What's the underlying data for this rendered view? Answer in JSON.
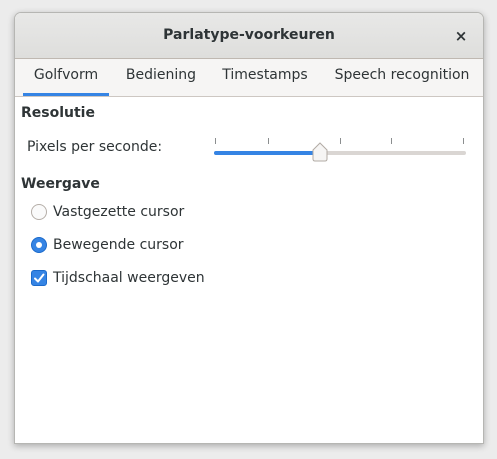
{
  "window": {
    "title": "Parlatype-voorkeuren",
    "close_glyph": "×"
  },
  "tabs": [
    {
      "label": "Golfvorm",
      "active": true
    },
    {
      "label": "Bediening",
      "active": false
    },
    {
      "label": "Timestamps",
      "active": false
    },
    {
      "label": "Speech recognition",
      "active": false
    }
  ],
  "resolution": {
    "heading": "Resolutie",
    "pixels_label": "Pixels per seconde:",
    "slider_value_fraction": 0.42,
    "tick_count": 5
  },
  "display": {
    "heading": "Weergave",
    "options": [
      {
        "label": "Vastgezette cursor",
        "type": "radio",
        "checked": false
      },
      {
        "label": "Bewegende cursor",
        "type": "radio",
        "checked": true
      },
      {
        "label": "Tijdschaal weergeven",
        "type": "checkbox",
        "checked": true
      }
    ]
  },
  "colors": {
    "accent": "#3584e4",
    "text": "#2e3436"
  }
}
